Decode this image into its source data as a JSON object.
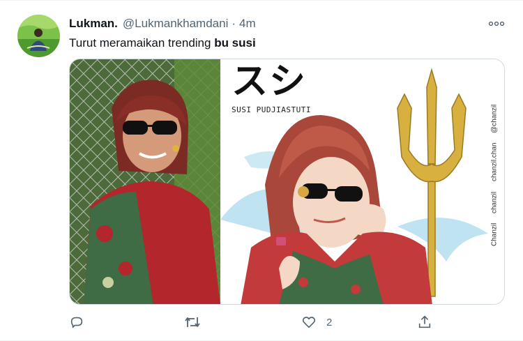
{
  "tweet": {
    "display_name": "Lukman.",
    "handle": "@Lukmankhamdani",
    "separator": "·",
    "time": "4m",
    "text_prefix": "Turut meramaikan trending ",
    "text_bold": "bu susi"
  },
  "media": {
    "right_panel": {
      "kana_title": "スシ",
      "caption": "SUSI PUDJIASTUTI",
      "watermarks": [
        "@chanzil",
        "chanzil.chan",
        "chanzil",
        "Chanzil"
      ]
    }
  },
  "actions": {
    "reply": {
      "icon": "reply-icon",
      "count": ""
    },
    "retweet": {
      "icon": "retweet-icon",
      "count": ""
    },
    "like": {
      "icon": "heart-icon",
      "count": "2"
    },
    "share": {
      "icon": "share-icon",
      "count": ""
    }
  },
  "colors": {
    "icon_gray": "#536471",
    "border": "#cfd9de",
    "text": "#0f1419"
  }
}
